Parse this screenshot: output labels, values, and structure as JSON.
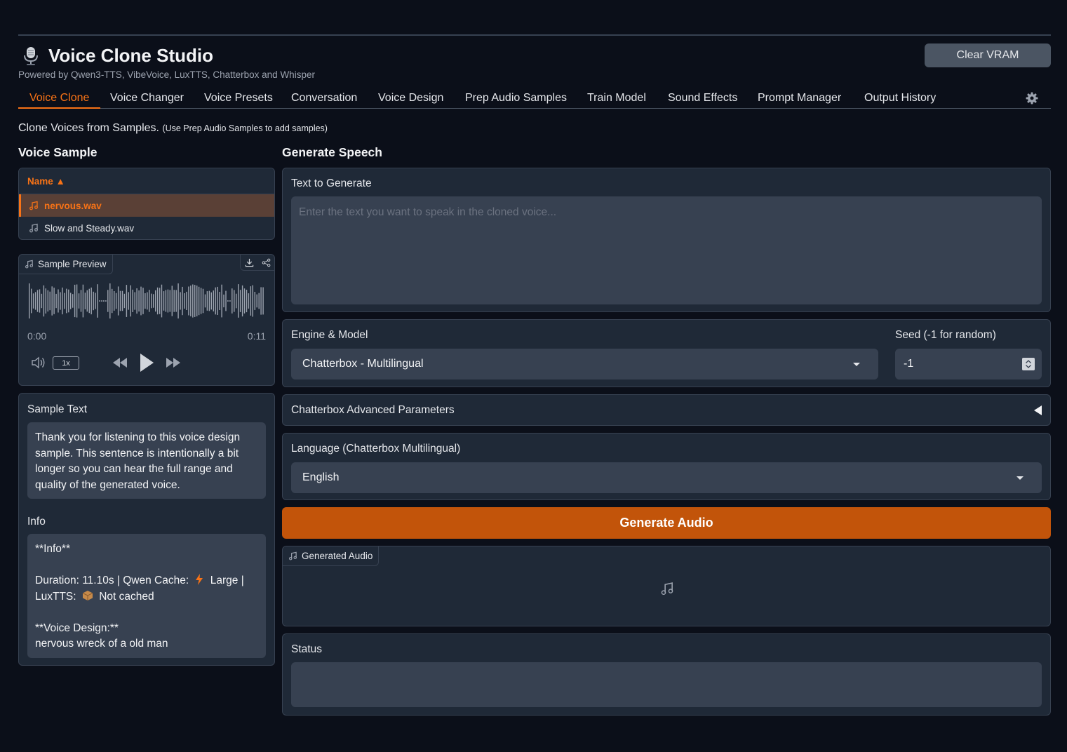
{
  "header": {
    "title": "Voice Clone Studio",
    "subtitle": "Powered by Qwen3-TTS, VibeVoice, LuxTTS, Chatterbox and Whisper",
    "clear_vram_label": "Clear VRAM"
  },
  "tabs": [
    {
      "label": "Voice Clone",
      "active": true
    },
    {
      "label": "Voice Changer"
    },
    {
      "label": "Voice Presets"
    },
    {
      "label": "Conversation"
    },
    {
      "label": "Voice Design"
    },
    {
      "label": "Prep Audio Samples"
    },
    {
      "label": "Train Model"
    },
    {
      "label": "Sound Effects"
    },
    {
      "label": "Prompt Manager"
    },
    {
      "label": "Output History"
    }
  ],
  "description": {
    "main": "Clone Voices from Samples.",
    "hint": "(Use Prep Audio Samples to add samples)"
  },
  "voice_sample": {
    "heading": "Voice Sample",
    "column_header": "Name ▲",
    "files": [
      {
        "name": "nervous.wav",
        "selected": true
      },
      {
        "name": "Slow and Steady.wav"
      }
    ],
    "preview": {
      "label": "Sample Preview",
      "current_time": "0:00",
      "duration": "0:11",
      "speed": "1x"
    },
    "sample_text_label": "Sample Text",
    "sample_text": "Thank you for listening to this voice design sample. This sentence is intentionally a bit longer so you can hear the full range and quality of the generated voice.",
    "info_label": "Info",
    "info": {
      "title": "**Info**",
      "line1_a": "Duration: 11.10s | Qwen Cache:",
      "line1_b": "Large |",
      "line2_a": "LuxTTS:",
      "line2_b": "Not cached",
      "design_title": "**Voice Design:**",
      "design_value": "nervous wreck of a old man"
    }
  },
  "generate": {
    "heading": "Generate Speech",
    "text_label": "Text to Generate",
    "text_placeholder": "Enter the text you want to speak in the cloned voice...",
    "engine_label": "Engine & Model",
    "engine_value": "Chatterbox - Multilingual",
    "seed_label": "Seed (-1 for random)",
    "seed_value": "-1",
    "advanced_label": "Chatterbox Advanced Parameters",
    "language_label": "Language (Chatterbox Multilingual)",
    "language_value": "English",
    "generate_button": "Generate Audio",
    "generated_audio_label": "Generated Audio",
    "status_label": "Status"
  },
  "colors": {
    "accent": "#f97316",
    "button": "#c2540a",
    "background": "#0b0f19",
    "panel": "#1f2937"
  },
  "icons": [
    "microphone-icon",
    "settings-icon",
    "music-note-icon",
    "download-icon",
    "share-icon",
    "volume-icon",
    "rewind-icon",
    "play-icon",
    "fast-forward-icon",
    "lightning-icon",
    "package-icon"
  ]
}
